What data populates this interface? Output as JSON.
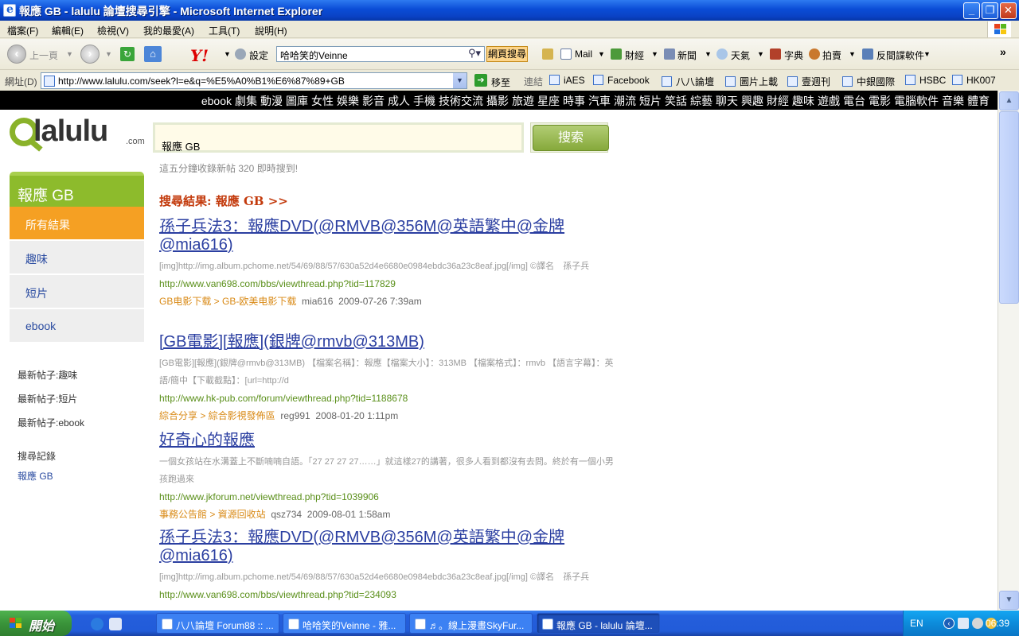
{
  "window": {
    "title": "報應 GB - lalulu 論壇搜尋引擎 - Microsoft Internet Explorer",
    "controls": [
      "_",
      "❐",
      "✕"
    ]
  },
  "menubar": [
    "檔案(F)",
    "編輯(E)",
    "檢視(V)",
    "我的最愛(A)",
    "工具(T)",
    "說明(H)"
  ],
  "toolbar": {
    "back": "上一頁",
    "yahoo_logo": "Y!",
    "settings": "設定",
    "search_value": "哈哈笑的Veinne",
    "web_search": "網頁搜尋",
    "mail": "Mail",
    "finance": "財經",
    "news": "新聞",
    "weather": "天氣",
    "dictionary": "字典",
    "auction": "拍賣",
    "antispy": "反間諜軟件"
  },
  "addressbar": {
    "label": "網址(D)",
    "url": "http://www.lalulu.com/seek?l=e&q=%E5%A0%B1%E6%87%89+GB",
    "go": "移至",
    "links_label": "連結",
    "links": [
      "iAES",
      "Facebook",
      "八八論壇",
      "圖片上載",
      "壹週刊",
      "中銀國際",
      "HSBC",
      "HK007"
    ]
  },
  "site": {
    "categories": [
      "ebook",
      "劇集",
      "動漫",
      "圖庫",
      "女性",
      "娛樂",
      "影音",
      "成人",
      "手機",
      "技術交流",
      "攝影",
      "旅遊",
      "星座",
      "時事",
      "汽車",
      "潮流",
      "短片",
      "笑話",
      "綜藝",
      "聊天",
      "興趣",
      "財經",
      "趣味",
      "遊戲",
      "電台",
      "電影",
      "電腦軟件",
      "音樂",
      "體育"
    ],
    "logo_word": "lalulu",
    "logo_com": ".com",
    "search_value": "報應 GB",
    "search_button": "搜索",
    "stats": "這五分鐘收錄新帖 320 即時搜到!"
  },
  "sidebar": {
    "heading": "報應 GB",
    "items": [
      "所有結果",
      "趣味",
      "短片",
      "ebook"
    ],
    "latest": [
      "最新帖子:趣味",
      "最新帖子:短片",
      "最新帖子:ebook"
    ],
    "history_label": "搜尋記錄",
    "history_item": "報應 GB"
  },
  "results_heading": "搜尋結果: 報應 GB >>",
  "results": [
    {
      "title": "孫子兵法3：報應DVD(@RMVB@356M@英語繁中@金牌@mia616)",
      "snippet": "[img]http://img.album.pchome.net/54/69/88/57/630a52d4e6680e0984ebdc36a23c8eaf.jpg[/img] ©譯名　孫子兵",
      "url": "http://www.van698.com/bbs/viewthread.php?tid=117829",
      "category": "GB电影下载 > GB-欧美电影下载",
      "user": "mia616",
      "date": "2009-07-26 7:39am"
    },
    {
      "title": "[GB電影][報應](銀牌@rmvb@313MB)",
      "snippet": "[GB電影][報應](銀牌@rmvb@313MB) 【檔案名稱】：報應【檔案大小】：313MB 【檔案格式】：rmvb 【語言字幕】：英語/簡中【下載截點】：[url=http://d",
      "url": "http://www.hk-pub.com/forum/viewthread.php?tid=1188678",
      "category": "綜合分享 > 綜合影視發佈區",
      "user": "reg991",
      "date": "2008-01-20 1:11pm"
    },
    {
      "title": "好奇心的報應",
      "snippet": "一個女孩站在水溝蓋上不斷喃喃自語。「27 27 27 27……」就這樣27的講著，很多人看到都沒有去問。終於有一個小男孩跑過來",
      "url": "http://www.jkforum.net/viewthread.php?tid=1039906",
      "category": "事務公告館 > 資源回收站",
      "user": "qsz734",
      "date": "2009-08-01 1:58am"
    },
    {
      "title": "孫子兵法3：報應DVD(@RMVB@356M@英語繁中@金牌@mia616)",
      "snippet": "[img]http://img.album.pchome.net/54/69/88/57/630a52d4e6680e0984ebdc36a23c8eaf.jpg[/img] ©譯名　孫子兵",
      "url": "http://www.van698.com/bbs/viewthread.php?tid=234093",
      "category": "",
      "user": "",
      "date": ""
    }
  ],
  "taskbar": {
    "start": "開始",
    "tasks": [
      "八八論壇 Forum88 :: ...",
      "哈哈笑的Veinne - 雅...",
      "♬。線上漫畫SkyFur...",
      "報應 GB - lalulu 論壇..."
    ],
    "lang": "EN",
    "clock": "06:39"
  }
}
